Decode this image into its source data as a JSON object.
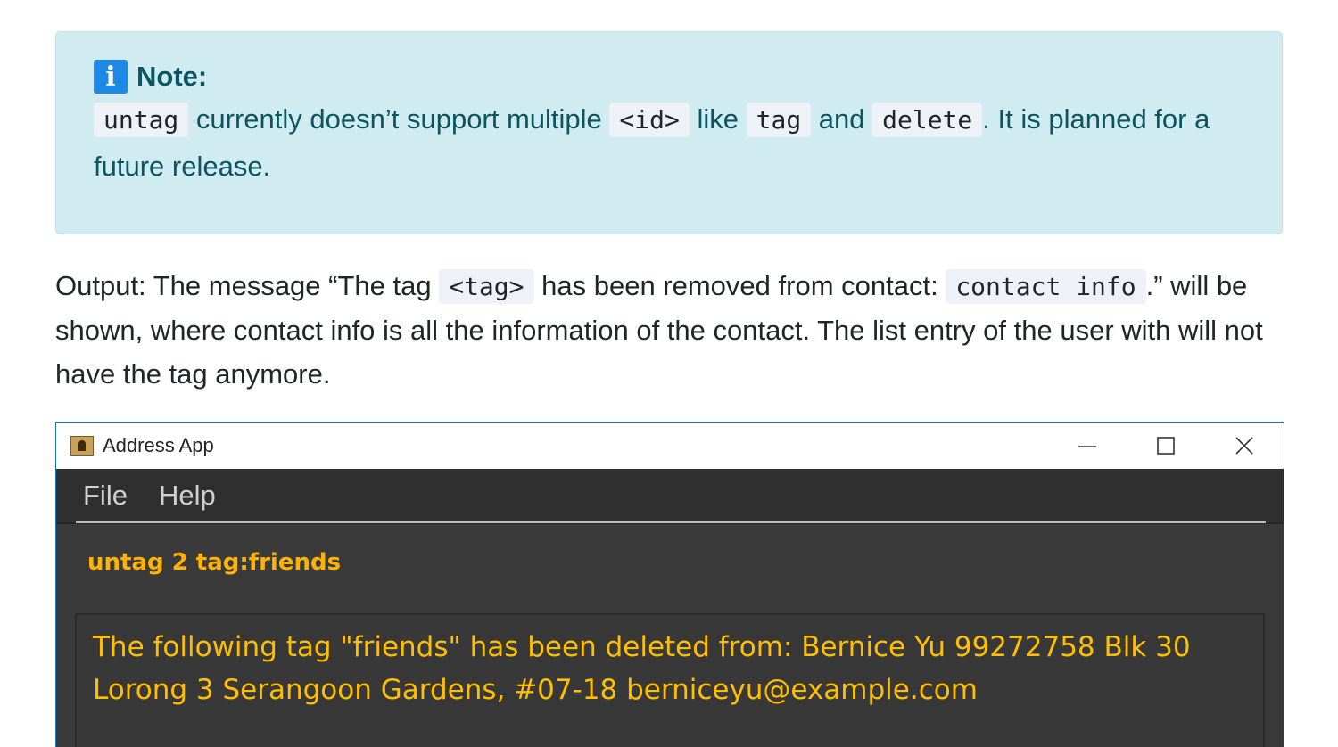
{
  "note": {
    "icon": "info-icon",
    "icon_glyph": "i",
    "title": "Note:",
    "code_untag": "untag",
    "text1": " currently doesn’t support multiple ",
    "code_id": "<id>",
    "text2": " like ",
    "code_tag": "tag",
    "text3": " and ",
    "code_delete": "delete",
    "text4": ". It is planned for a future release."
  },
  "output": {
    "text1": "Output: The message “The tag ",
    "code_tag": "<tag>",
    "text2": " has been removed from contact: ",
    "code_contact": "contact info",
    "text3": ".” will be shown, where contact info is all the information of the contact. The list entry of the user with will not have the tag anymore."
  },
  "window": {
    "title": "Address App",
    "menu": [
      "File",
      "Help"
    ],
    "command": "untag 2 tag:friends",
    "result": "The following tag \"friends\" has been deleted from: Bernice Yu 99272758 Blk 30 Lorong 3 Serangoon Gardens, #07-18 berniceyu@example.com"
  },
  "colors": {
    "note_bg": "#d1ecf1",
    "note_text": "#0c5460",
    "info_icon": "#1e88e5",
    "app_bg": "#3a3a3a",
    "command_text": "#ffb300",
    "result_text": "#ffbf00"
  }
}
